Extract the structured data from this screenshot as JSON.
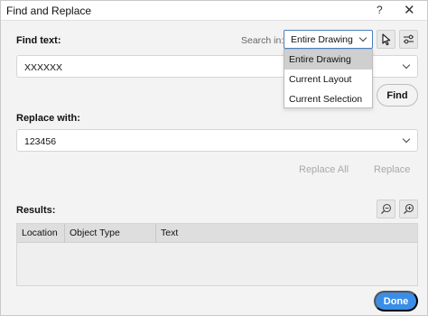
{
  "window": {
    "title": "Find and Replace",
    "help_label": "?",
    "close_label": "✕"
  },
  "find": {
    "label": "Find text:",
    "value": "XXXXXX",
    "search_in_label": "Search in:",
    "scope_selected": "Entire Drawing",
    "scope_options": [
      "Entire Drawing",
      "Current Layout",
      "Current Selection"
    ],
    "find_button": "Find"
  },
  "replace": {
    "label": "Replace with:",
    "value": "123456",
    "replace_all_button": "Replace All",
    "replace_button": "Replace"
  },
  "results": {
    "label": "Results:",
    "columns": [
      "Location",
      "Object Type",
      "Text"
    ]
  },
  "footer": {
    "done_button": "Done"
  },
  "colors": {
    "accent": "#3b8ee6",
    "disabled_text": "#a9a9a9"
  }
}
